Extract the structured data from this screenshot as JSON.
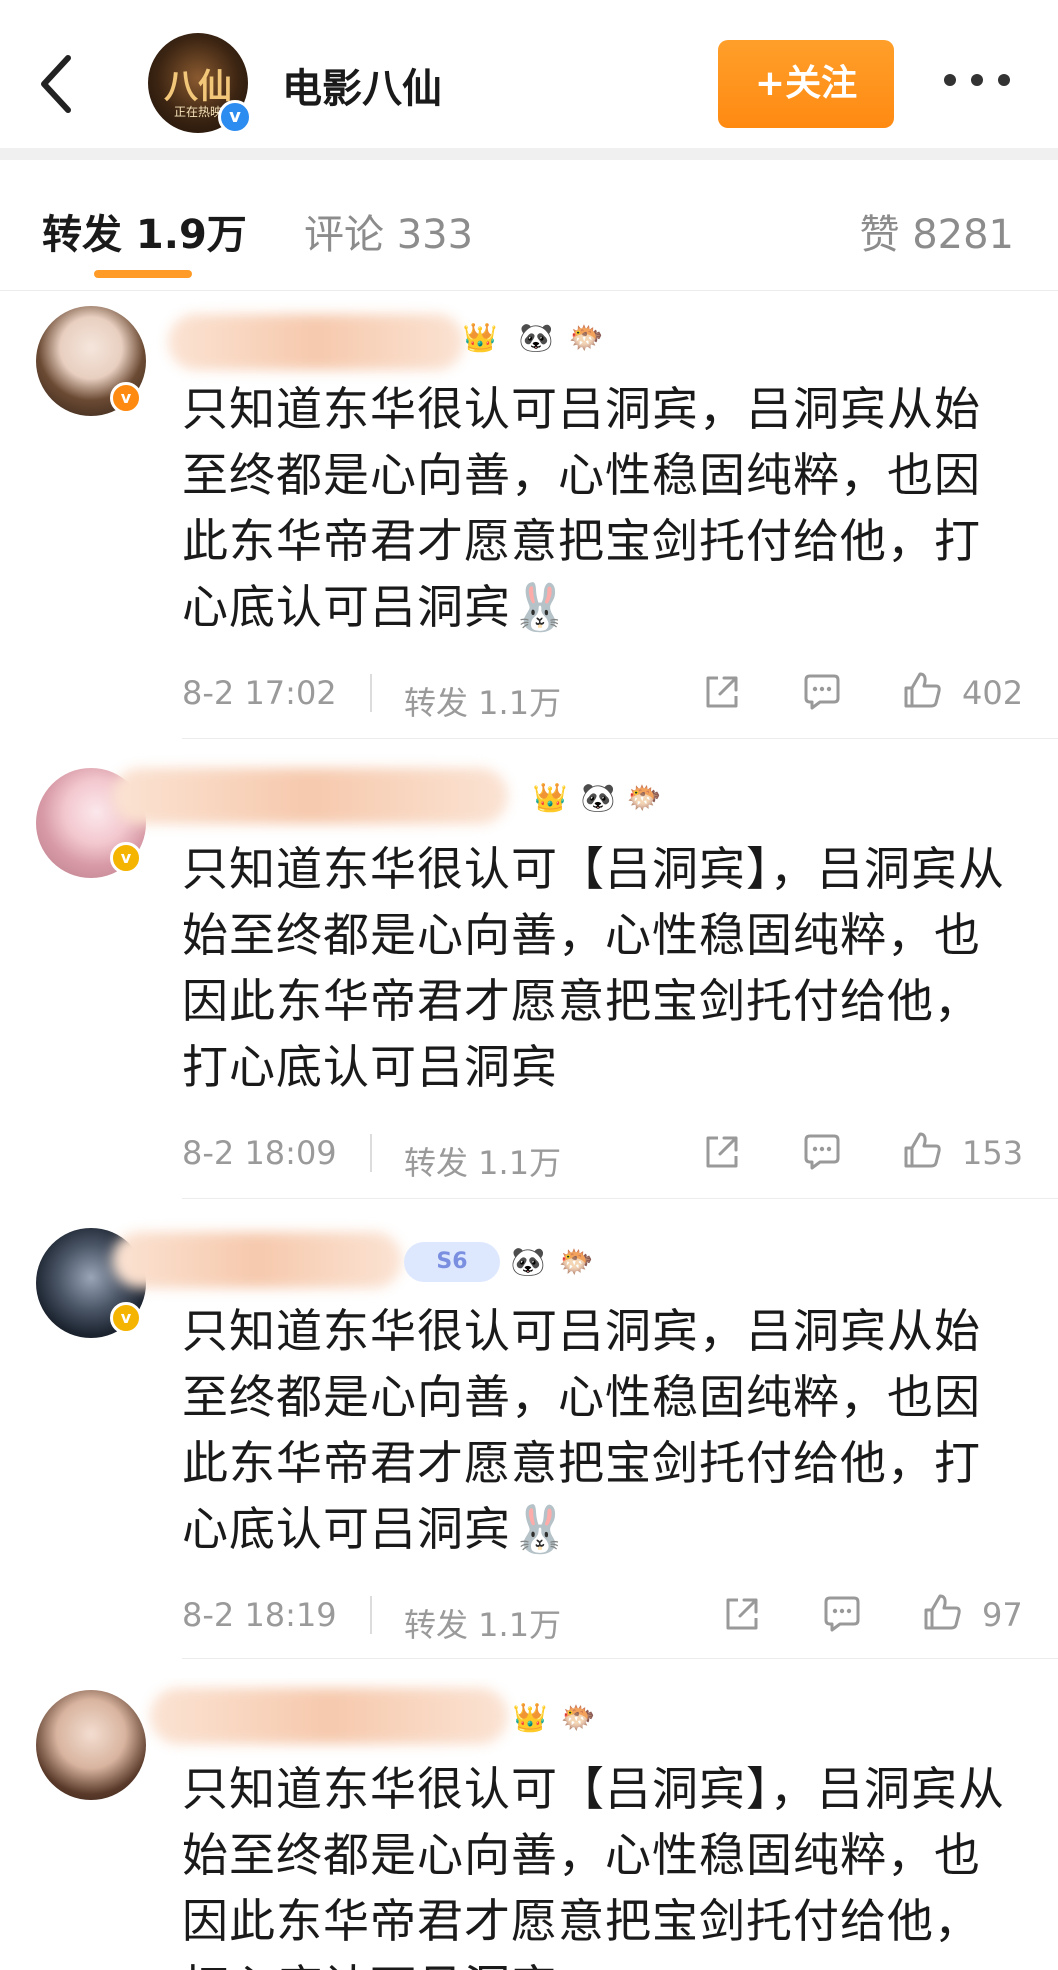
{
  "header": {
    "account_name": "电影八仙",
    "avatar_logo": "八仙",
    "avatar_sub": "正在热映",
    "follow_label": "+关注",
    "icons": {
      "back": "chevron-left-icon",
      "more": "more-dots-icon",
      "verified": "verified-badge-icon"
    },
    "colors": {
      "follow": "#ff8a12",
      "verified": "#2d8cf0"
    }
  },
  "tabs": {
    "repost": "转发 1.9万",
    "comments": "评论 333",
    "likes": "赞 8281",
    "active_color": "#ff9b26"
  },
  "comments": [
    {
      "text": "只知道东华很认可吕洞宾，吕洞宾从始至终都是心向善，心性稳固纯粹，也因此东华帝君才愿意把宝剑托付给他，打心底认可吕洞宾🐰",
      "time": "8-2 17:02",
      "repost": "转发 1.1万",
      "likes": "402",
      "badges": [
        "👑",
        "🐼",
        "🐡"
      ]
    },
    {
      "text": "只知道东华很认可【吕洞宾】，吕洞宾从始至终都是心向善，心性稳固纯粹，也因此东华帝君才愿意把宝剑托付给他，打心底认可吕洞宾",
      "time": "8-2 18:09",
      "repost": "转发 1.1万",
      "likes": "153",
      "badges": [
        "👑",
        "🐼",
        "🐡"
      ]
    },
    {
      "text": "只知道东华很认可吕洞宾，吕洞宾从始至终都是心向善，心性稳固纯粹，也因此东华帝君才愿意把宝剑托付给他，打心底认可吕洞宾🐰",
      "time": "8-2 18:19",
      "repost": "转发 1.1万",
      "likes": "97",
      "badges": [
        "S6",
        "🐼",
        "🐡"
      ]
    },
    {
      "text": "只知道东华很认可【吕洞宾】，吕洞宾从始至终都是心向善，心性稳固纯粹，也因此东华帝君才愿意把宝剑托付给他，打心底认可吕洞宾",
      "badges": [
        "👑",
        "🐡"
      ]
    }
  ]
}
